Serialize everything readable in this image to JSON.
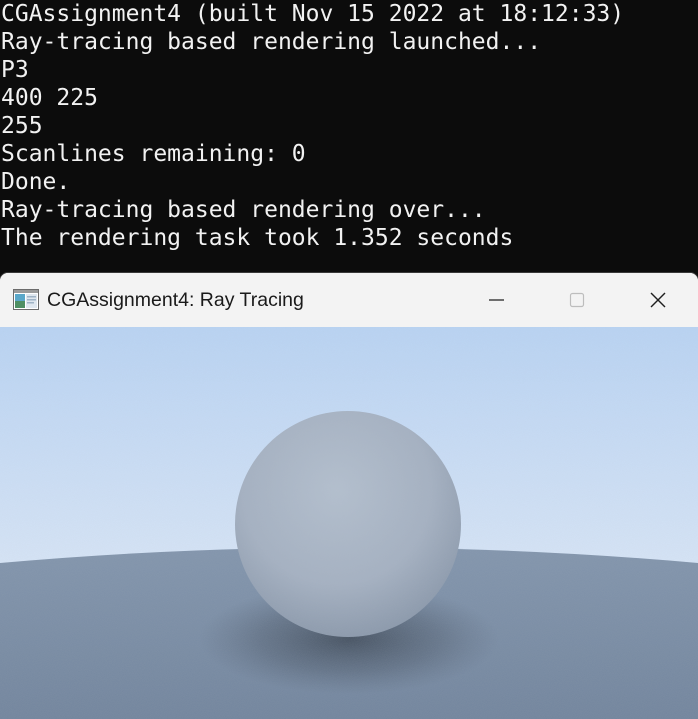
{
  "console": {
    "lines": [
      "CGAssignment4 (built Nov 15 2022 at 18:12:33)",
      "Ray-tracing based rendering launched...",
      "P3",
      "400 225",
      "255",
      "Scanlines remaining: 0",
      "Done.",
      "Ray-tracing based rendering over...",
      "The rendering task took 1.352 seconds"
    ],
    "text_color": "#f2f2f2",
    "background": "#0c0c0c"
  },
  "window": {
    "title": "CGAssignment4: Ray Tracing",
    "app_icon": "app-window-icon",
    "controls": {
      "minimize_icon": "minimize-icon",
      "maximize_icon": "maximize-icon",
      "close_icon": "close-icon"
    }
  },
  "render": {
    "sky_top_color": "#b9d5f7",
    "sky_horizon_color": "#e6eefa",
    "sphere_color": "#a7b4c4",
    "ground_color": "#7d90a8"
  }
}
